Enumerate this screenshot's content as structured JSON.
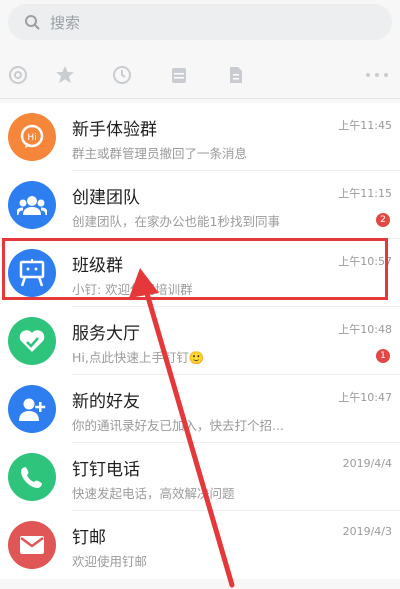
{
  "search": {
    "placeholder": "搜索"
  },
  "toolbar": {
    "icons": [
      "at-icon",
      "star-icon",
      "clock-icon",
      "calendar-icon",
      "document-icon",
      "more-icon"
    ]
  },
  "colors": {
    "blue": "#2f7ef0",
    "green": "#2fc47c",
    "orange": "#f5863a",
    "red": "#e05555",
    "highlight": "#e5383b"
  },
  "chats": [
    {
      "name": "新手体验群",
      "message": "群主或群管理员撤回了一条消息",
      "time": "上午11:45",
      "badge": ""
    },
    {
      "name": "创建团队",
      "message": "创建团队，在家办公也能1秒找到同事",
      "time": "上午11:15",
      "badge": "2"
    },
    {
      "name": "班级群",
      "message": "小钉: 欢迎使用培训群",
      "time": "上午10:57",
      "badge": ""
    },
    {
      "name": "服务大厅",
      "message": "Hi,点此快速上手钉钉🙂",
      "time": "上午10:48",
      "badge": "1"
    },
    {
      "name": "新的好友",
      "message": "你的通讯录好友已加入，快去打个招...",
      "time": "上午10:47",
      "badge": ""
    },
    {
      "name": "钉钉电话",
      "message": "快速发起电话，高效解决问题",
      "time": "2019/4/4",
      "badge": ""
    },
    {
      "name": "钉邮",
      "message": "欢迎使用钉邮",
      "time": "2019/4/3",
      "badge": ""
    }
  ]
}
